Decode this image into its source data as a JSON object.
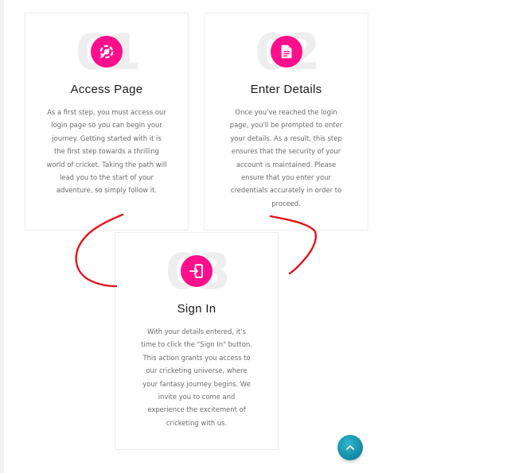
{
  "steps": [
    {
      "number": "01",
      "icon": "edit-gear-icon",
      "title": "Access Page",
      "description": "As a first step, you must access our login page so you can begin your journey. Getting started with it is the first step towards a thrilling world of cricket. Taking the path will lead you to the start of your adventure, so simply follow it."
    },
    {
      "number": "02",
      "icon": "document-icon",
      "title": "Enter Details",
      "description": "Once you've reached the login page, you'll be prompted to enter your details. As a result, this step ensures that the security of your account is maintained. Please ensure that you enter your credentials accurately in order to proceed."
    },
    {
      "number": "03",
      "icon": "sign-in-icon",
      "title": "Sign In",
      "description": "With your details entered, it's time to click the \"Sign In\" button. This action grants you access to our cricketing universe, where your fantasy journey begins. We invite you to come and experience the excitement of cricketing with us."
    }
  ],
  "colors": {
    "accent": "#ff0f8b",
    "annotation": "#e0161d",
    "scroll_button": "#1b97b0"
  },
  "scroll_top": {
    "icon": "chevron-up-icon"
  }
}
